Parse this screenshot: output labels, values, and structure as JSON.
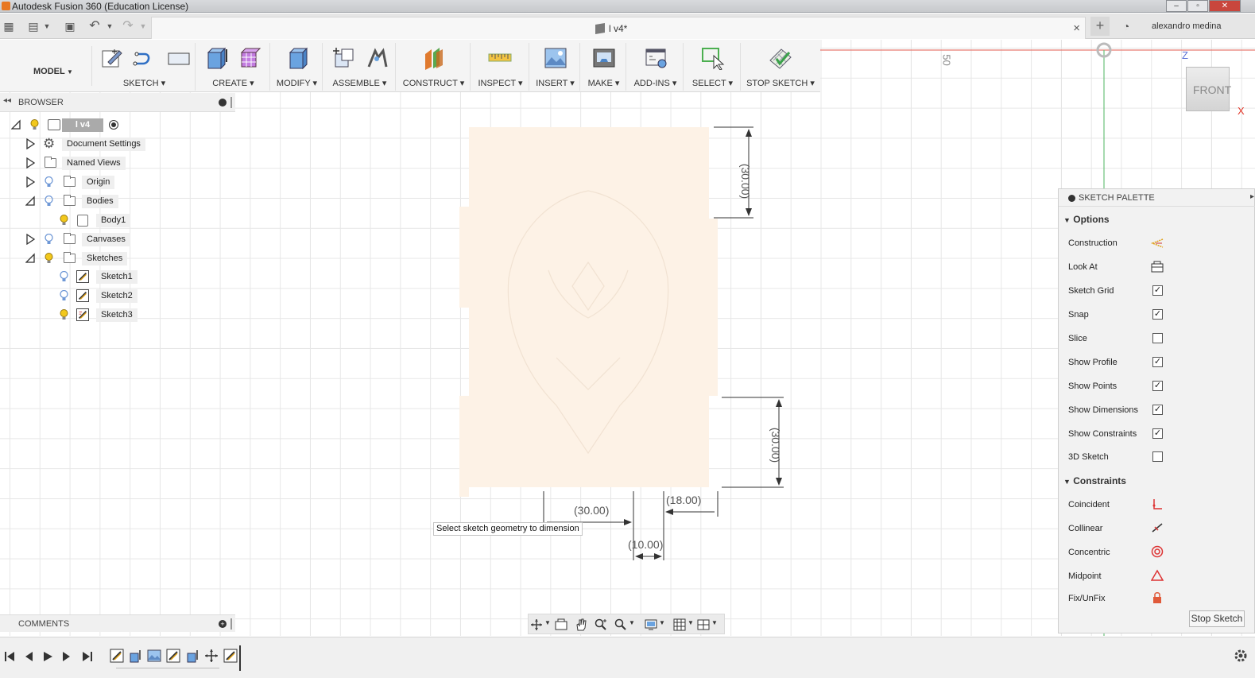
{
  "window": {
    "title": "Autodesk Fusion 360 (Education License)"
  },
  "document": {
    "tab_title": "l v4*",
    "close_glyph": "×",
    "add_glyph": "+"
  },
  "user": {
    "name": "alexandro medina"
  },
  "toolbar": {
    "workspace": "MODEL",
    "groups": [
      {
        "label": "SKETCH"
      },
      {
        "label": "CREATE"
      },
      {
        "label": "MODIFY"
      },
      {
        "label": "ASSEMBLE"
      },
      {
        "label": "CONSTRUCT"
      },
      {
        "label": "INSPECT"
      },
      {
        "label": "INSERT"
      },
      {
        "label": "MAKE"
      },
      {
        "label": "ADD-INS"
      },
      {
        "label": "SELECT"
      },
      {
        "label": "STOP SKETCH"
      }
    ]
  },
  "browser": {
    "title": "BROWSER",
    "root": "l v4",
    "items": [
      {
        "label": "Document Settings",
        "icon": "gear-icon"
      },
      {
        "label": "Named Views",
        "icon": "folder-icon"
      },
      {
        "label": "Origin",
        "icon": "folder-icon"
      },
      {
        "label": "Bodies",
        "icon": "folder-icon"
      },
      {
        "label": "Body1",
        "icon": "body-icon"
      },
      {
        "label": "Canvases",
        "icon": "folder-icon"
      },
      {
        "label": "Sketches",
        "icon": "folder-icon"
      },
      {
        "label": "Sketch1",
        "icon": "sketch-icon"
      },
      {
        "label": "Sketch2",
        "icon": "sketch-icon"
      },
      {
        "label": "Sketch3",
        "icon": "sketch-icon"
      }
    ]
  },
  "comments": {
    "title": "COMMENTS"
  },
  "canvas": {
    "ruler_label": "50",
    "viewcube_face": "FRONT",
    "axis_z": "Z",
    "axis_x": "X",
    "dimensions": [
      "(30.00)",
      "(30.00)",
      "(30.00)",
      "(18.00)",
      "(10.00)"
    ],
    "tooltip": "Select sketch geometry to dimension"
  },
  "palette": {
    "title": "SKETCH PALETTE",
    "options_title": "Options",
    "options": [
      {
        "label": "Construction",
        "type": "icon"
      },
      {
        "label": "Look At",
        "type": "icon"
      },
      {
        "label": "Sketch Grid",
        "checked": true
      },
      {
        "label": "Snap",
        "checked": true
      },
      {
        "label": "Slice",
        "checked": false
      },
      {
        "label": "Show Profile",
        "checked": true
      },
      {
        "label": "Show Points",
        "checked": true
      },
      {
        "label": "Show Dimensions",
        "checked": true
      },
      {
        "label": "Show Constraints",
        "checked": true
      },
      {
        "label": "3D Sketch",
        "checked": false
      }
    ],
    "constraints_title": "Constraints",
    "constraints": [
      {
        "label": "Coincident"
      },
      {
        "label": "Collinear"
      },
      {
        "label": "Concentric"
      },
      {
        "label": "Midpoint"
      },
      {
        "label": "Fix/UnFix"
      }
    ],
    "stop_button": "Stop Sketch"
  },
  "colors": {
    "accent_red": "#e23b2e",
    "axis_green": "#3bb34a",
    "sketch_fill": "#fdf2e6",
    "bulb_yellow": "#f2c81c",
    "bulb_blue": "#8db3e6"
  }
}
